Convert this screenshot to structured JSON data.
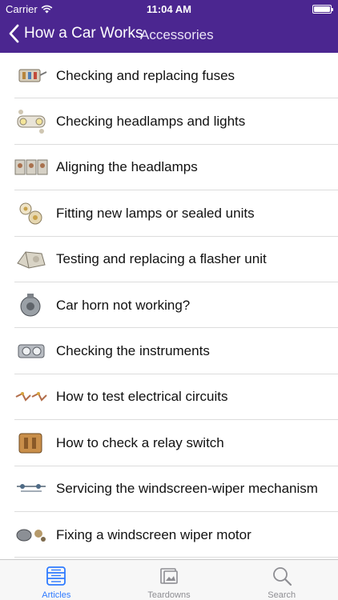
{
  "status_bar": {
    "carrier": "Carrier",
    "time": "11:04 AM"
  },
  "nav": {
    "back_label": "How a Car Works",
    "title": "Accessories"
  },
  "items": [
    {
      "label": "Checking and replacing fuses",
      "icon": "fuse-box-icon"
    },
    {
      "label": "Checking headlamps and lights",
      "icon": "headlamp-icon"
    },
    {
      "label": "Aligning the headlamps",
      "icon": "headlamp-alignment-icon"
    },
    {
      "label": "Fitting new lamps or sealed units",
      "icon": "lamp-unit-icon"
    },
    {
      "label": "Testing and replacing a flasher unit",
      "icon": "flasher-unit-icon"
    },
    {
      "label": "Car horn not working?",
      "icon": "car-horn-icon"
    },
    {
      "label": "Checking the instruments",
      "icon": "instrument-panel-icon"
    },
    {
      "label": "How to test electrical circuits",
      "icon": "circuit-test-icon"
    },
    {
      "label": "How to check a relay switch",
      "icon": "relay-switch-icon"
    },
    {
      "label": "Servicing the windscreen-wiper mechanism",
      "icon": "wiper-mechanism-icon"
    },
    {
      "label": "Fixing a windscreen wiper motor",
      "icon": "wiper-motor-icon"
    }
  ],
  "tabs": [
    {
      "label": "Articles",
      "icon": "articles-icon",
      "active": true
    },
    {
      "label": "Teardowns",
      "icon": "teardowns-icon",
      "active": false
    },
    {
      "label": "Search",
      "icon": "search-icon",
      "active": false
    }
  ],
  "colors": {
    "nav_background": "#4b2690",
    "tab_active": "#2f7bff",
    "tab_inactive": "#8e8e93"
  }
}
